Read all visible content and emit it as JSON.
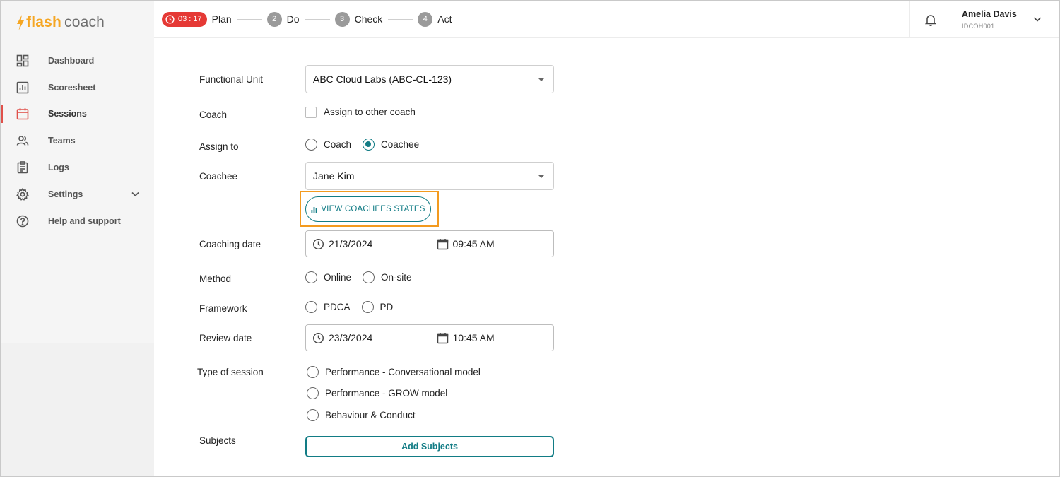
{
  "app": {
    "logo_flash": "flash",
    "logo_coach": "coach",
    "accent": "#127c85",
    "logo_color": "#f5a623"
  },
  "sidebar": {
    "items": [
      {
        "label": "Dashboard",
        "icon": "dashboard-icon"
      },
      {
        "label": "Scoresheet",
        "icon": "scoresheet-icon"
      },
      {
        "label": "Sessions",
        "icon": "calendar-icon",
        "active": true
      },
      {
        "label": "Teams",
        "icon": "teams-icon"
      },
      {
        "label": "Logs",
        "icon": "clipboard-icon"
      },
      {
        "label": "Settings",
        "icon": "gear-icon"
      },
      {
        "label": "Help and support",
        "icon": "help-icon"
      }
    ]
  },
  "topbar": {
    "timer": "03 : 17",
    "steps": [
      {
        "num": "",
        "label": "Plan"
      },
      {
        "num": "2",
        "label": "Do"
      },
      {
        "num": "3",
        "label": "Check"
      },
      {
        "num": "4",
        "label": "Act"
      }
    ],
    "user_name": "Amelia Davis",
    "user_id": "IDCOH001"
  },
  "form": {
    "functional_unit": {
      "label": "Functional Unit",
      "value": "ABC Cloud Labs (ABC-CL-123)"
    },
    "coach": {
      "label": "Coach",
      "checkbox_label": "Assign to other coach",
      "checked": false
    },
    "assign_to": {
      "label": "Assign to",
      "options": [
        "Coach",
        "Coachee"
      ],
      "selected": "Coachee"
    },
    "coachee": {
      "label": "Coachee",
      "value": "Jane Kim"
    },
    "view_button": "VIEW COACHEES STATES",
    "coaching_date": {
      "label": "Coaching date",
      "date": "21/3/2024",
      "time": "09:45 AM"
    },
    "method": {
      "label": "Method",
      "options": [
        "Online",
        "On-site"
      ]
    },
    "framework": {
      "label": "Framework",
      "options": [
        "PDCA",
        "PD"
      ]
    },
    "review_date": {
      "label": "Review date",
      "date": "23/3/2024",
      "time": "10:45 AM"
    },
    "session_type": {
      "label": "Type of session",
      "options": [
        "Performance - Conversational model",
        "Performance - GROW model",
        "Behaviour & Conduct"
      ]
    },
    "subjects": {
      "label": "Subjects",
      "button": "Add Subjects"
    }
  }
}
